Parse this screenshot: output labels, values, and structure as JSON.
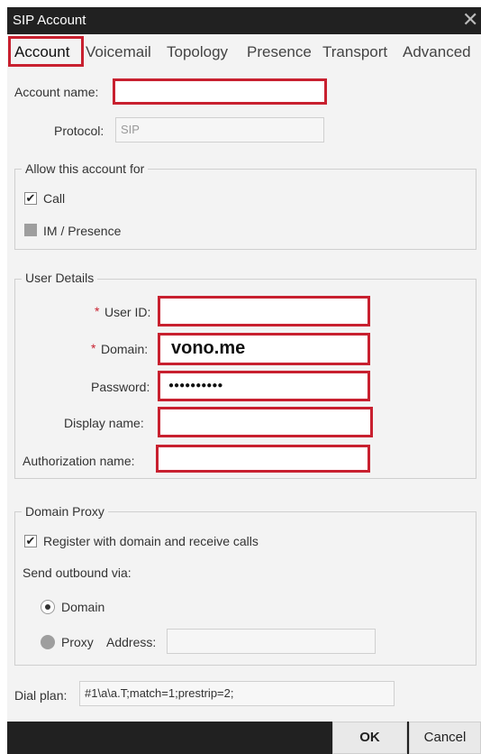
{
  "window": {
    "title": "SIP Account",
    "close_glyph": "✕"
  },
  "tabs": [
    {
      "label": "Account"
    },
    {
      "label": "Voicemail"
    },
    {
      "label": "Topology"
    },
    {
      "label": "Presence"
    },
    {
      "label": "Transport"
    },
    {
      "label": "Advanced"
    }
  ],
  "account": {
    "account_name_label": "Account name:",
    "account_name_value": "",
    "protocol_label": "Protocol:",
    "protocol_value": "SIP"
  },
  "allow": {
    "legend": "Allow this account for",
    "call_label": "Call",
    "call_checked": true,
    "im_label": "IM / Presence",
    "im_checked": false
  },
  "user_details": {
    "legend": "User Details",
    "required_mark": "*",
    "user_id_label": "User ID:",
    "user_id_value": "",
    "domain_label": "Domain:",
    "domain_value": "vono.me",
    "password_label": "Password:",
    "password_value": "●●●●●●●●●●",
    "display_name_label": "Display name:",
    "display_name_value": "",
    "auth_name_label": "Authorization name:",
    "auth_name_value": ""
  },
  "domain_proxy": {
    "legend": "Domain Proxy",
    "register_label": "Register with domain and receive calls",
    "register_checked": true,
    "send_via_label": "Send outbound via:",
    "domain_option": "Domain",
    "proxy_option": "Proxy",
    "address_label": "Address:",
    "address_value": ""
  },
  "dial_plan": {
    "label": "Dial plan:",
    "value": "#1\\a\\a.T;match=1;prestrip=2;"
  },
  "buttons": {
    "ok": "OK",
    "cancel": "Cancel"
  },
  "colors": {
    "highlight": "#c8202f",
    "titlebar": "#212121",
    "dialog_bg": "#f3f3f3"
  },
  "icons": {
    "check": "✔"
  }
}
